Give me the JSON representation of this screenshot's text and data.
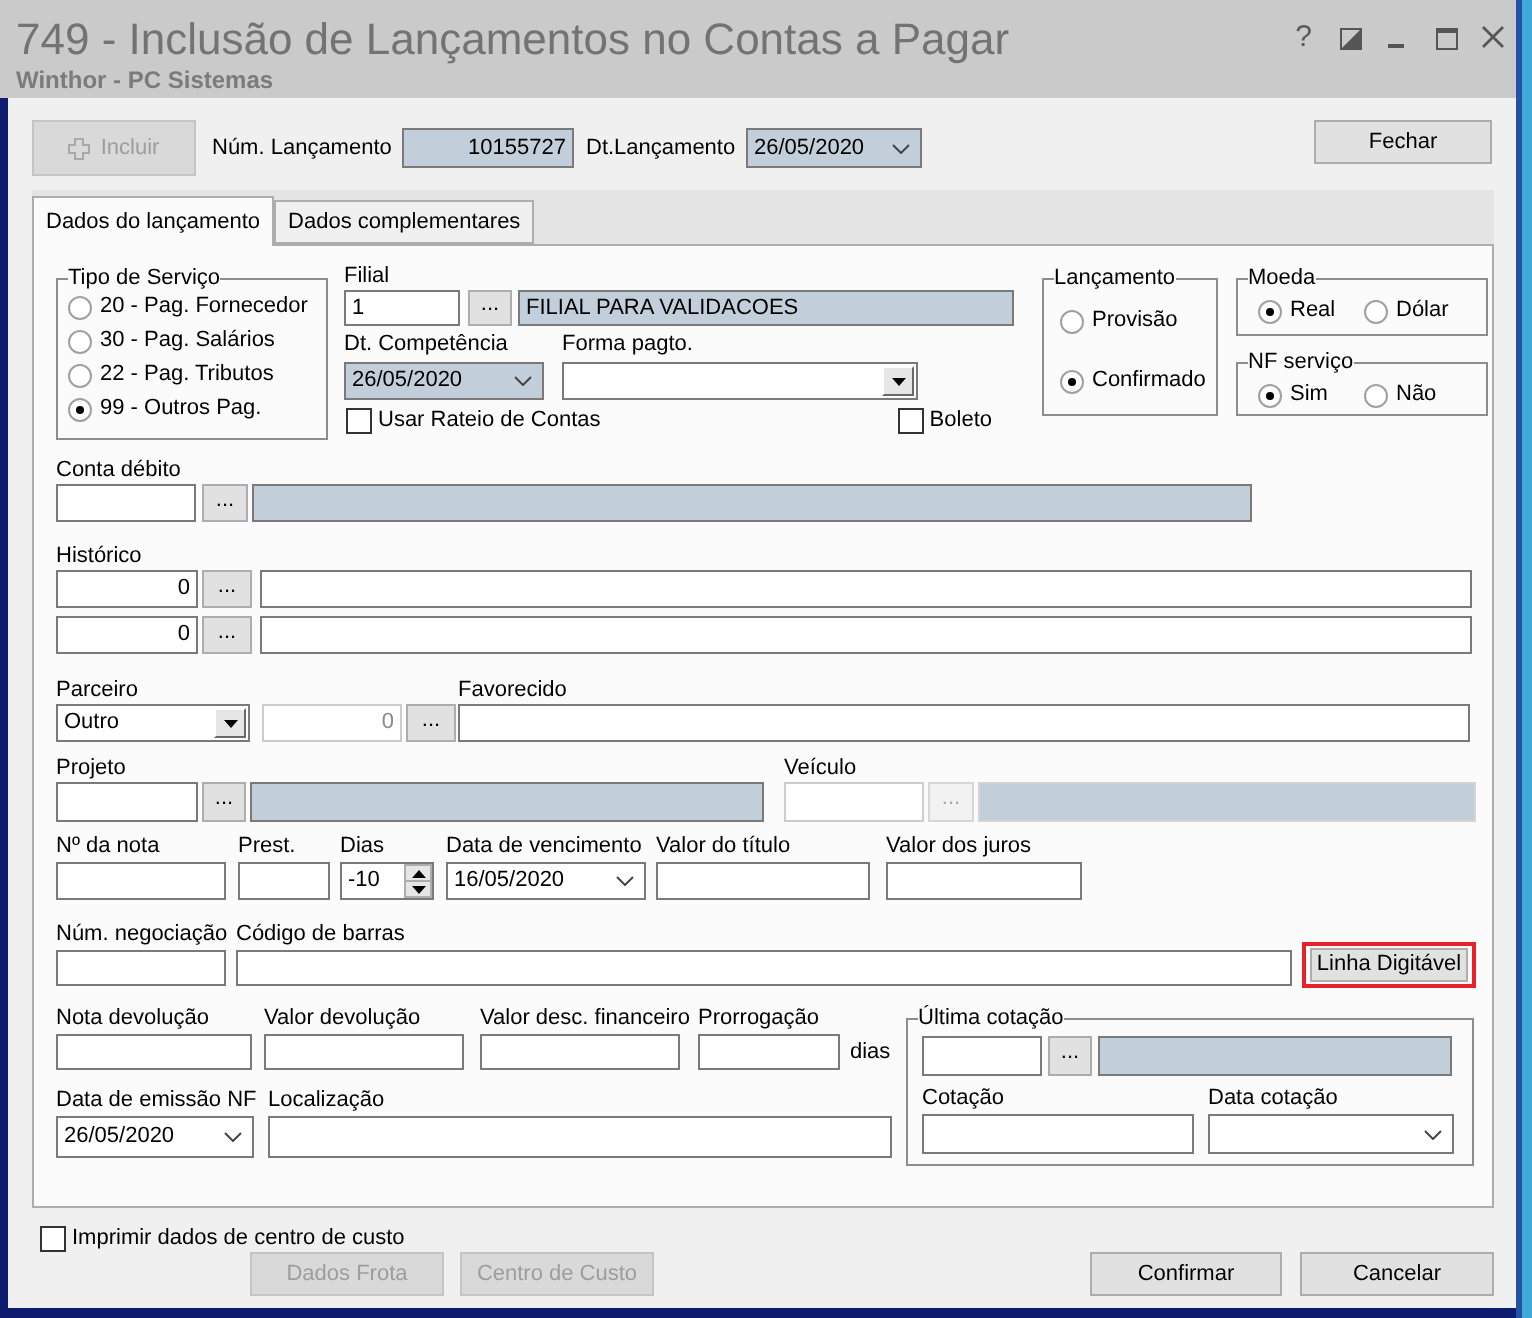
{
  "window": {
    "title": "749 - Inclusão de Lançamentos no Contas a Pagar",
    "subtitle": "Winthor - PC Sistemas",
    "help": "?"
  },
  "toolbar": {
    "add_button": {
      "label": "Incluir",
      "disabled": true
    },
    "num_lancamento": {
      "label": "Núm. Lançamento",
      "value": "10155727"
    },
    "dt_lancamento": {
      "label": "Dt.Lançamento",
      "value": "26/05/2020",
      "readonly": true
    },
    "close_button": {
      "label": "Fechar",
      "disabled": false
    }
  },
  "tabs": [
    {
      "label": "Dados do lançamento",
      "selected": true
    },
    {
      "label": "Dados complementares",
      "selected": false
    }
  ],
  "tipo_servico": {
    "legend": "Tipo de Serviço",
    "options": [
      {
        "label": "20 - Pag. Fornecedor",
        "selected": false
      },
      {
        "label": "30 - Pag. Salários",
        "selected": false
      },
      {
        "label": "22 - Pag. Tributos",
        "selected": false
      },
      {
        "label": "99 - Outros Pag.",
        "selected": true
      }
    ]
  },
  "filial": {
    "label": "Filial",
    "code": "1",
    "button": "...",
    "name": "FILIAL PARA VALIDACOES"
  },
  "dt_competencia": {
    "label": "Dt. Competência",
    "value": "26/05/2020",
    "readonly": true
  },
  "forma_pagto": {
    "label": "Forma pagto."
  },
  "usar_rateio": {
    "label": "Usar Rateio de Contas",
    "checked": false
  },
  "boleto": {
    "label": "Boleto",
    "checked": false
  },
  "lancamento": {
    "legend": "Lançamento",
    "options": [
      {
        "label": "Provisão",
        "selected": false
      },
      {
        "label": "Confirmado",
        "selected": true
      }
    ]
  },
  "moeda": {
    "legend": "Moeda",
    "options": [
      {
        "label": "Real",
        "selected": true
      },
      {
        "label": "Dólar",
        "selected": false
      }
    ]
  },
  "nf_servico": {
    "legend": "NF serviço",
    "options": [
      {
        "label": "Sim",
        "selected": true
      },
      {
        "label": "Não",
        "selected": false
      }
    ]
  },
  "conta_debito": {
    "label": "Conta débito",
    "button": "..."
  },
  "historico": {
    "label": "Histórico",
    "rows": [
      {
        "code": "0",
        "button": "..."
      },
      {
        "code": "0",
        "button": "..."
      }
    ]
  },
  "parceiro": {
    "label": "Parceiro",
    "value": "Outro",
    "code": "0",
    "code_disabled": true,
    "button": "..."
  },
  "favorecido": {
    "label": "Favorecido"
  },
  "projeto": {
    "label": "Projeto",
    "button": "...",
    "disabled": false
  },
  "veiculo": {
    "label": "Veículo",
    "button": "...",
    "disabled": true
  },
  "titulo_fields": [
    {
      "kind": "text",
      "label": "Nº da nota"
    },
    {
      "kind": "text",
      "label": "Prest."
    },
    {
      "kind": "spin",
      "label": "Dias",
      "value": "-10"
    },
    {
      "kind": "date",
      "label": "Data de vencimento",
      "value": "16/05/2020",
      "readonly": false
    },
    {
      "kind": "text",
      "label": "Valor do título"
    },
    {
      "kind": "text",
      "label": "Valor dos juros"
    }
  ],
  "negociacao": {
    "num_negociacao": {
      "label": "Núm. negociação"
    },
    "codigo_barras": {
      "label": "Código de barras"
    },
    "linha_digitavel": {
      "label": "Linha Digitável",
      "highlighted": true
    }
  },
  "devolucao_fields": [
    {
      "kind": "text",
      "label": "Nota devolução"
    },
    {
      "kind": "text",
      "label": "Valor devolução"
    },
    {
      "kind": "text",
      "label": "Valor desc. financeiro"
    },
    {
      "kind": "text",
      "label": "Prorrogação",
      "suffix": "dias"
    }
  ],
  "emissao_fields": [
    {
      "kind": "date",
      "label": "Data de emissão NF",
      "value": "26/05/2020",
      "readonly": false
    },
    {
      "kind": "text",
      "label": "Localização"
    }
  ],
  "ultima_cotacao": {
    "legend": "Última cotação",
    "button": "...",
    "fields": [
      {
        "kind": "text",
        "label": "Cotação"
      },
      {
        "kind": "date",
        "label": "Data cotação",
        "readonly": false
      }
    ]
  },
  "footer": {
    "print_cost_center": {
      "label": "Imprimir dados de centro de custo",
      "checked": false
    },
    "buttons": [
      {
        "label": "Dados Frota",
        "disabled": true
      },
      {
        "label": "Centro de Custo",
        "disabled": true
      },
      {
        "label": "Confirmar",
        "disabled": false
      },
      {
        "label": "Cancelar",
        "disabled": false
      }
    ]
  }
}
